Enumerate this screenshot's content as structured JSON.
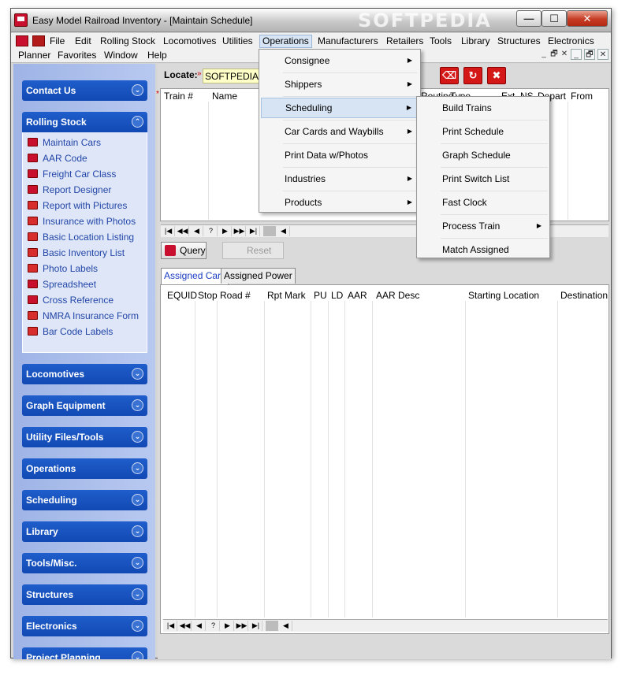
{
  "window": {
    "title": "Easy Model Railroad Inventory - [Maintain Schedule]",
    "watermark": "SOFTPEDIA",
    "minimize": "—",
    "maximize": "☐",
    "close": "✕"
  },
  "menubar": {
    "row1": [
      "File",
      "Edit",
      "Rolling Stock",
      "Locomotives",
      "Utilities",
      "Operations",
      "Manufacturers",
      "Retailers",
      "Tools",
      "Library",
      "Structures",
      "Electronics"
    ],
    "row2": [
      "Planner",
      "Favorites",
      "Window",
      "Help"
    ],
    "active": "Operations",
    "mdi_controls": [
      "_",
      "🗗",
      "✕",
      "_",
      "🗗",
      "✕"
    ]
  },
  "sidebar": {
    "sections": [
      {
        "label": "Contact Us",
        "chevron": "⌄"
      },
      {
        "label": "Rolling Stock",
        "chevron": "⌃"
      },
      {
        "label": "Locomotives",
        "chevron": "⌄"
      },
      {
        "label": "Graph Equipment",
        "chevron": "⌄"
      },
      {
        "label": "Utility Files/Tools",
        "chevron": "⌄"
      },
      {
        "label": "Operations",
        "chevron": "⌄"
      },
      {
        "label": "Scheduling",
        "chevron": "⌄"
      },
      {
        "label": "Library",
        "chevron": "⌄"
      },
      {
        "label": "Tools/Misc.",
        "chevron": "⌄"
      },
      {
        "label": "Structures",
        "chevron": "⌄"
      },
      {
        "label": "Electronics",
        "chevron": "⌄"
      },
      {
        "label": "Project Planning",
        "chevron": "⌄"
      }
    ],
    "rolling_stock_items": [
      "Maintain Cars",
      "AAR Code",
      "Freight Car Class",
      "Report Designer",
      "Report with Pictures",
      "Insurance with Photos",
      "Basic Location Listing",
      "Basic Inventory List",
      "Photo Labels",
      "Spreadsheet",
      "Cross Reference",
      "NMRA Insurance Form",
      "Bar Code Labels"
    ]
  },
  "locate": {
    "label": "Locate:",
    "value": "SOFTPEDIA",
    "marker": "»"
  },
  "top_grid": {
    "columns": [
      "Train #",
      "Name",
      "Routing",
      "Type",
      "Ext",
      "NS",
      "Depart",
      "From"
    ],
    "marker": "*"
  },
  "nav_buttons": [
    "|◀",
    "◀◀",
    "◀",
    "?",
    "▶",
    "▶▶",
    "▶|"
  ],
  "query_button": "Query",
  "reset_button": "Reset",
  "tabs": [
    "Assigned Cars",
    "Assigned Power"
  ],
  "bottom_grid": {
    "columns": [
      "EQUID",
      "Stop",
      "Road #",
      "Rpt Mark",
      "PU",
      "LD",
      "AAR",
      "AAR Desc",
      "Starting Location",
      "Destination"
    ]
  },
  "operations_menu": {
    "items": [
      {
        "label": "Consignee",
        "arrow": "▶"
      },
      {
        "label": "Shippers",
        "arrow": "▶"
      },
      {
        "label": "Scheduling",
        "arrow": "▶"
      },
      {
        "label": "Car Cards and Waybills",
        "arrow": "▶"
      },
      {
        "label": "Print Data w/Photos",
        "arrow": ""
      },
      {
        "label": "Industries",
        "arrow": "▶"
      },
      {
        "label": "Products",
        "arrow": "▶"
      }
    ]
  },
  "scheduling_menu": {
    "items": [
      {
        "label": "Build Trains",
        "arrow": ""
      },
      {
        "label": "Print Schedule",
        "arrow": ""
      },
      {
        "label": "Graph Schedule",
        "arrow": ""
      },
      {
        "label": "Print Switch List",
        "arrow": ""
      },
      {
        "label": "Fast Clock",
        "arrow": ""
      },
      {
        "label": "Process Train",
        "arrow": "▶"
      },
      {
        "label": "Match Assigned",
        "arrow": ""
      }
    ]
  }
}
